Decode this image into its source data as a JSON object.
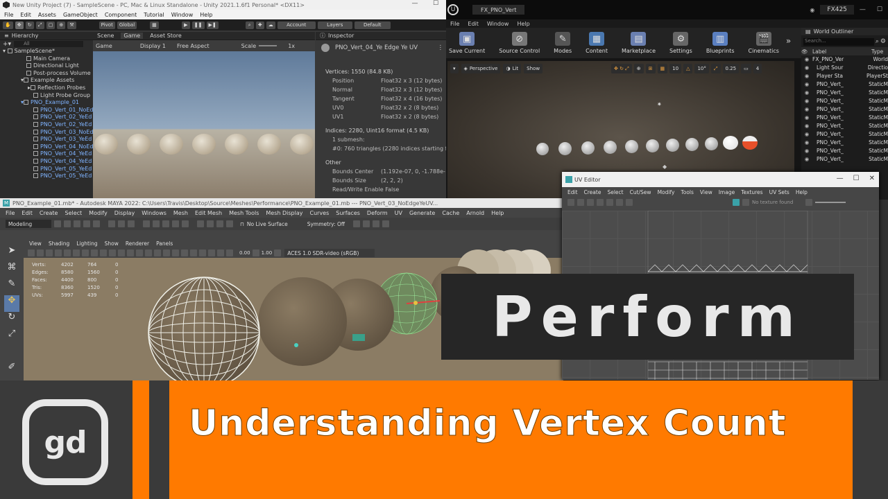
{
  "unity": {
    "title": "New Unity Project (7) - SampleScene - PC, Mac & Linux Standalone - Unity 2021.1.6f1 Personal* <DX11>",
    "menu": [
      "File",
      "Edit",
      "Assets",
      "GameObject",
      "Component",
      "Tutorial",
      "Window",
      "Help"
    ],
    "toolbar": {
      "pivot": "Pivot",
      "global": "Global",
      "account": "Account",
      "layers": "Layers",
      "layout": "Default"
    },
    "hierarchy": {
      "title": "Hierarchy",
      "search_placeholder": "All",
      "items": [
        "SampleScene*",
        "Main Camera",
        "Directional Light",
        "Post-process Volume",
        "Example Assets",
        "Reflection Probes",
        "Light Probe Group",
        "PNO_Example_01",
        "PNO_Vert_01_NoEd",
        "PNO_Vert_02_YeEd",
        "PNO_Vert_02_YeEd",
        "PNO_Vert_03_NoEd",
        "PNO_Vert_03_YeEd",
        "PNO_Vert_04_NoEd",
        "PNO_Vert_04_YeEd",
        "PNO_Vert_04_YeEd",
        "PNO_Vert_05_YeEd",
        "PNO_Vert_05_YeEd"
      ]
    },
    "game": {
      "tab_scene": "Scene",
      "tab_game": "Game",
      "tab_store": "Asset Store",
      "mode": "Game",
      "display": "Display 1",
      "aspect": "Free Aspect",
      "scale_label": "Scale",
      "scale_value": "1x"
    },
    "inspector": {
      "title": "Inspector",
      "object": "PNO_Vert_04_Ye Edge Ye UV",
      "vertices_header": "Vertices: 1550 (84.8 KB)",
      "attributes": [
        {
          "name": "Position",
          "format": "Float32 x 3 (12 bytes)"
        },
        {
          "name": "Normal",
          "format": "Float32 x 3 (12 bytes)"
        },
        {
          "name": "Tangent",
          "format": "Float32 x 4 (16 bytes)"
        },
        {
          "name": "UV0",
          "format": "Float32 x 2 (8 bytes)"
        },
        {
          "name": "UV1",
          "format": "Float32 x 2 (8 bytes)"
        }
      ],
      "indices_header": "Indices: 2280, Uint16 format (4.5 KB)",
      "submesh": "1 submesh:",
      "submesh_detail": "#0: 760 triangles (2280 indices starting fro",
      "other": "Other",
      "bounds_center_label": "Bounds Center",
      "bounds_center": "(1.192e-07, 0, -1.788e-",
      "bounds_size_label": "Bounds Size",
      "bounds_size": "(2, 2, 2)",
      "readwrite": "Read/Write Enable False"
    }
  },
  "unreal": {
    "tab": "FX_PNO_Vert",
    "project": "FX425",
    "menu": [
      "File",
      "Edit",
      "Window",
      "Help"
    ],
    "tools": [
      {
        "label": "Save Current",
        "icon": "save-icon",
        "color": "#6a7fb0"
      },
      {
        "label": "Source Control",
        "icon": "source-control-icon",
        "color": "#777"
      },
      {
        "label": "Modes",
        "icon": "modes-icon",
        "color": "#999"
      },
      {
        "label": "Content",
        "icon": "content-icon",
        "color": "#4a78b0"
      },
      {
        "label": "Marketplace",
        "icon": "marketplace-icon",
        "color": "#6a7fb0"
      },
      {
        "label": "Settings",
        "icon": "settings-icon",
        "color": "#888"
      },
      {
        "label": "Blueprints",
        "icon": "blueprints-icon",
        "color": "#5a7fc0"
      },
      {
        "label": "Cinematics",
        "icon": "cinematics-icon",
        "color": "#888"
      }
    ],
    "viewport": {
      "perspective": "Perspective",
      "lit": "Lit",
      "show": "Show",
      "grid": "10",
      "angle": "10°",
      "scale": "0.25",
      "cams": "4"
    },
    "outliner": {
      "title": "World Outliner",
      "search_placeholder": "Search...",
      "col_label": "Label",
      "col_type": "Type",
      "rows": [
        {
          "label": "FX_PNO_Ver",
          "type": "World"
        },
        {
          "label": "Light Sour",
          "type": "Directio"
        },
        {
          "label": "Player Sta",
          "type": "PlayerSt"
        },
        {
          "label": "PNO_Vert_",
          "type": "StaticM"
        },
        {
          "label": "PNO_Vert_",
          "type": "StaticM"
        },
        {
          "label": "PNO_Vert_",
          "type": "StaticM"
        },
        {
          "label": "PNO_Vert_",
          "type": "StaticM"
        },
        {
          "label": "PNO_Vert_",
          "type": "StaticM"
        },
        {
          "label": "PNO_Vert_",
          "type": "StaticM"
        },
        {
          "label": "PNO_Vert_",
          "type": "StaticM"
        },
        {
          "label": "PNO_Vert_",
          "type": "StaticM"
        },
        {
          "label": "PNO_Vert_",
          "type": "StaticM"
        },
        {
          "label": "PNO_Vert_",
          "type": "StaticM"
        }
      ]
    }
  },
  "maya": {
    "title": "PNO_Example_01.mb* - Autodesk MAYA 2022: C:\\Users\\Travis\\Desktop\\Source\\Meshes\\Performance\\PNO_Example_01.mb  ---  PNO_Vert_03_NoEdgeYeUV...",
    "menu": [
      "File",
      "Edit",
      "Create",
      "Select",
      "Modify",
      "Display",
      "Windows",
      "Mesh",
      "Edit Mesh",
      "Mesh Tools",
      "Mesh Display",
      "Curves",
      "Surfaces",
      "Deform",
      "UV",
      "Generate",
      "Cache",
      "Arnold",
      "Help"
    ],
    "mode": "Modeling",
    "live": "No Live Surface",
    "symmetry": "Symmetry: Off",
    "vpmenu": [
      "View",
      "Shading",
      "Lighting",
      "Show",
      "Renderer",
      "Panels"
    ],
    "exposure": "0.00",
    "gamma": "1.00",
    "colorspace": "ACES 1.0 SDR-video (sRGB)",
    "hud": [
      {
        "label": "Verts:",
        "a": "4202",
        "b": "764",
        "c": "0"
      },
      {
        "label": "Edges:",
        "a": "8580",
        "b": "1560",
        "c": "0"
      },
      {
        "label": "Faces:",
        "a": "4400",
        "b": "800",
        "c": "0"
      },
      {
        "label": "Tris:",
        "a": "8360",
        "b": "1520",
        "c": "0"
      },
      {
        "label": "UVs:",
        "a": "5997",
        "b": "439",
        "c": "0"
      }
    ]
  },
  "uv_editor": {
    "title": "UV Editor",
    "menu": [
      "Edit",
      "Create",
      "Select",
      "Cut/Sew",
      "Modify",
      "Tools",
      "View",
      "Image",
      "Textures",
      "UV Sets",
      "Help"
    ],
    "no_texture": "No texture found"
  },
  "overlay": {
    "perform": "Perform",
    "headline": "Understanding Vertex Count",
    "logo": "gd"
  }
}
